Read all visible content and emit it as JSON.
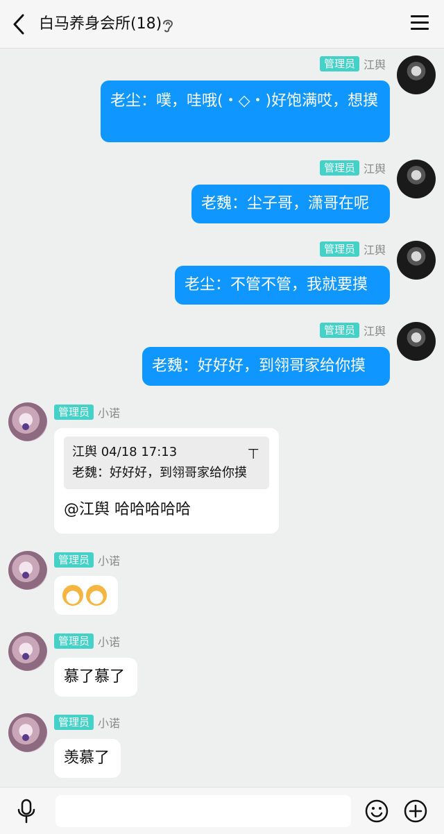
{
  "header": {
    "title": "白马养身会所(18)",
    "back_icon": "chevron-left-icon",
    "ear_icon": "ear-icon",
    "menu_icon": "menu-icon"
  },
  "messages": [
    {
      "sender": "江舆",
      "badge": "管理员",
      "text": "老尘：噗，哇哦(・◇・)好饱满哎，想摸",
      "outgoing": true
    },
    {
      "sender": "江舆",
      "badge": "管理员",
      "text": "老魏：尘子哥，潇哥在呢",
      "outgoing": true
    },
    {
      "sender": "江舆",
      "badge": "管理员",
      "text": "老尘：不管不管，我就要摸",
      "outgoing": true
    },
    {
      "sender": "江舆",
      "badge": "管理员",
      "text": "老魏：好好好，到翎哥家给你摸",
      "outgoing": true
    },
    {
      "sender": "小诺",
      "badge": "管理员",
      "outgoing": false,
      "quote": {
        "header": "江舆 04/18 17:13",
        "text": "老魏：好好好，到翎哥家给你摸",
        "pin_icon": "pin-icon"
      },
      "text": "@江舆 哈哈哈哈哈"
    },
    {
      "sender": "小诺",
      "badge": "管理员",
      "outgoing": false,
      "emoji": "dog-emoji"
    },
    {
      "sender": "小诺",
      "badge": "管理员",
      "text": "慕了慕了",
      "outgoing": false
    },
    {
      "sender": "小诺",
      "badge": "管理员",
      "text": "羡慕了",
      "outgoing": false
    }
  ],
  "composer": {
    "placeholder": "",
    "mic_icon": "microphone-icon",
    "emoji_icon": "smile-icon",
    "plus_icon": "plus-icon"
  }
}
